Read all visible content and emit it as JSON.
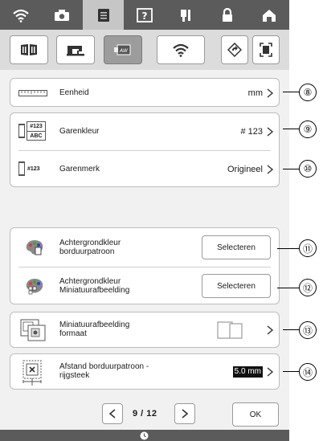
{
  "colors": {
    "topbar": "#5b5b5b",
    "screen_bg": "#f1f1f1",
    "active_tab": "#c6c6c6"
  },
  "top_tabs": [
    "wifi-icon",
    "camera-icon",
    "document-icon",
    "help-icon",
    "needle-icon",
    "lock-icon",
    "home-icon"
  ],
  "sub_tabs": [
    "book-icon",
    "sewing-machine-icon",
    "embroidery-frame-icon",
    "wifi-icon",
    "rotate-icon",
    "fullscreen-icon"
  ],
  "settings": {
    "unit": {
      "label": "Eenheid",
      "value": "mm",
      "callout": "⑧"
    },
    "thread_color": {
      "label": "Garenkleur",
      "value": "# 123",
      "callout": "⑨",
      "icon_text": "#123"
    },
    "thread_brand": {
      "label": "Garenmerk",
      "value": "Origineel",
      "callout": "⑩",
      "icon_text": "#123"
    },
    "bg_pattern": {
      "label_line1": "Achtergrondkleur",
      "label_line2": "borduurpatroon",
      "button": "Selecteren",
      "callout": "⑪"
    },
    "bg_thumb": {
      "label_line1": "Achtergrondkleur",
      "label_line2": "Miniatuurafbeelding",
      "button": "Selecteren",
      "callout": "⑫"
    },
    "thumb_size": {
      "label_line1": "Miniatuurafbeelding",
      "label_line2": "formaat",
      "callout": "⑬"
    },
    "distance": {
      "label_line1": "Afstand borduurpatroon -",
      "label_line2": "rijgsteek",
      "value": "5.0 mm",
      "callout": "⑭"
    }
  },
  "pager": {
    "text": "9 / 12",
    "ok": "OK"
  }
}
